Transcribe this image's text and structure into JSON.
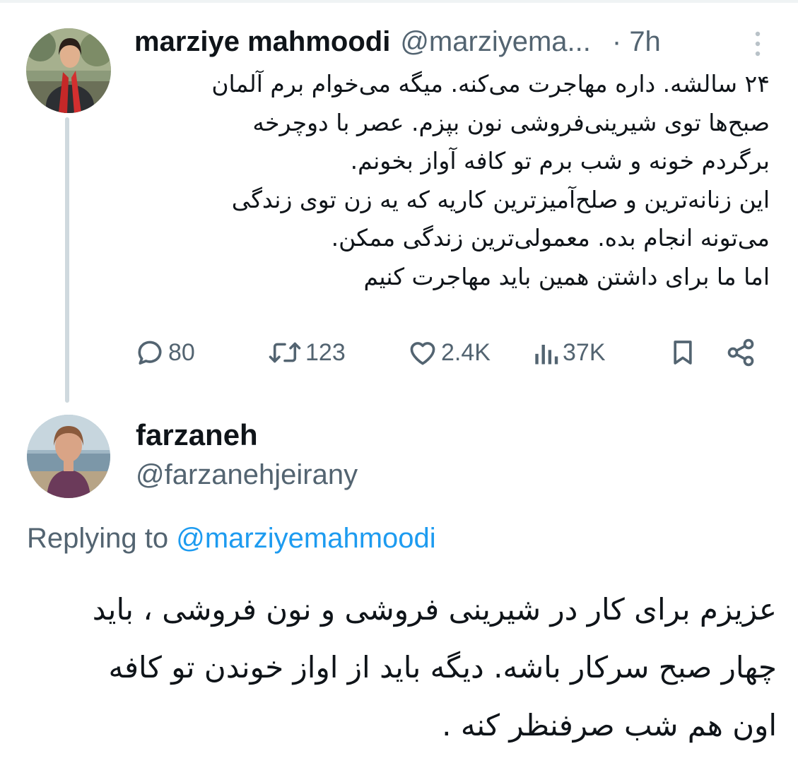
{
  "tweet": {
    "author_name": "marziye mahmoodi",
    "author_handle": "@marziyema...",
    "separator": "·",
    "time": "7h",
    "body_lines": [
      "۲۴ سالشه. داره مهاجرت می‌کنه. میگه می‌خوام برم آلمان",
      "صبح‌ها توی شیرینی‌فروشی نون بپزم. عصر با دوچرخه",
      "برگردم خونه و شب برم تو کافه آواز بخونم.",
      "این زنانه‌ترین و صلح‌آمیزترین کاریه که یه زن توی زندگی",
      "می‌تونه انجام بده. معمولی‌ترین زندگی ممکن.",
      "اما ما برای داشتن همین باید مهاجرت کنیم"
    ],
    "stats": {
      "replies": "80",
      "retweets": "123",
      "likes": "2.4K",
      "views": "37K"
    }
  },
  "reply": {
    "author_name": "farzaneh",
    "author_handle": "@farzanehjeirany",
    "replying_prefix": "Replying to",
    "replying_to": "@marziyemahmoodi",
    "body_lines": [
      "عزیزم برای کار در شیرینی فروشی و نون فروشی ، باید",
      "چهار صبح سرکار باشه. دیگه باید از اواز خوندن تو کافه",
      "اون هم شب  صرفنظر کنه ."
    ]
  },
  "icons": {
    "reply": "reply-icon",
    "retweet": "retweet-icon",
    "like": "heart-icon",
    "views": "views-icon",
    "bookmark": "bookmark-icon",
    "share": "share-icon",
    "more": "more-icon"
  },
  "colors": {
    "text": "#0f1419",
    "secondary": "#536471",
    "link": "#1d9bf0",
    "thread_line": "#cfd9de"
  }
}
